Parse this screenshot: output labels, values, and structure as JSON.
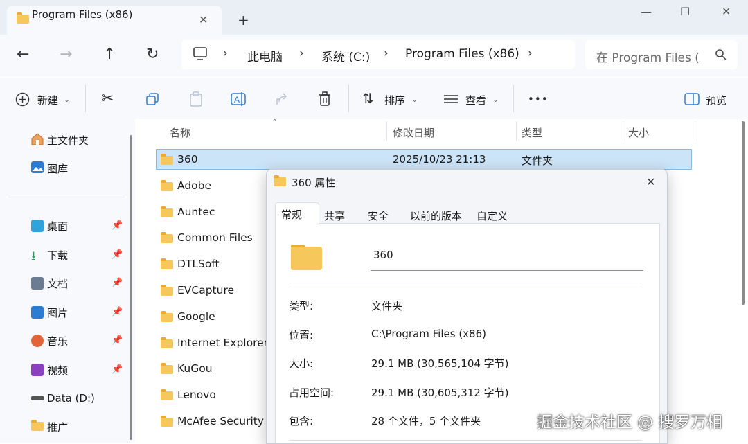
{
  "window": {
    "tab_title": "Program Files (x86)",
    "tab_close": "✕",
    "new_tab": "+",
    "minimize": "—",
    "maximize": "☐",
    "close": "✕"
  },
  "nav": {
    "back": "←",
    "forward": "→",
    "up": "↑",
    "refresh": "↻"
  },
  "breadcrumb": {
    "items": [
      "此电脑",
      "系统 (C:)",
      "Program Files (x86)"
    ],
    "separator": "›"
  },
  "search": {
    "placeholder": "在 Program Files (x"
  },
  "toolbar": {
    "new_label": "新建",
    "sort_label": "排序",
    "view_label": "查看",
    "more_label": "•••",
    "preview_label": "预览"
  },
  "sidebar": {
    "top_items": [
      {
        "label": "主文件夹",
        "icon": "home-icon"
      },
      {
        "label": "图库",
        "icon": "gallery-icon"
      }
    ],
    "pinned_items": [
      {
        "label": "桌面",
        "icon": "desktop-icon",
        "color": "#2fa3dc"
      },
      {
        "label": "下载",
        "icon": "download-icon",
        "color": "#2a9d5b"
      },
      {
        "label": "文档",
        "icon": "document-icon",
        "color": "#6b7c93"
      },
      {
        "label": "图片",
        "icon": "pictures-icon",
        "color": "#2b7cd3"
      },
      {
        "label": "音乐",
        "icon": "music-icon",
        "color": "#e0663a"
      },
      {
        "label": "视频",
        "icon": "video-icon",
        "color": "#8b3fc1"
      }
    ],
    "drive_items": [
      {
        "label": "Data (D:)",
        "icon": "drive-icon"
      },
      {
        "label": "推广",
        "icon": "folder-icon"
      }
    ]
  },
  "file_list": {
    "columns": [
      "名称",
      "修改日期",
      "类型",
      "大小"
    ],
    "rows": [
      {
        "name": "360",
        "date": "2025/10/23 21:13",
        "type": "文件夹",
        "selected": true
      },
      {
        "name": "Adobe"
      },
      {
        "name": "Auntec"
      },
      {
        "name": "Common Files"
      },
      {
        "name": "DTLSoft"
      },
      {
        "name": "EVCapture"
      },
      {
        "name": "Google"
      },
      {
        "name": "Internet Explorer"
      },
      {
        "name": "KuGou"
      },
      {
        "name": "Lenovo"
      },
      {
        "name": "McAfee Security"
      }
    ]
  },
  "dialog": {
    "title": "360 属性",
    "close": "✕",
    "tabs": [
      "常规",
      "共享",
      "安全",
      "以前的版本",
      "自定义"
    ],
    "active_tab": "常规",
    "name_value": "360",
    "props": [
      {
        "label": "类型:",
        "value": "文件夹"
      },
      {
        "label": "位置:",
        "value": "C:\\Program Files (x86)"
      },
      {
        "label": "大小:",
        "value": "29.1 MB (30,565,104 字节)"
      },
      {
        "label": "占用空间:",
        "value": "29.1 MB (30,605,312 字节)"
      },
      {
        "label": "包含:",
        "value": "28 个文件，5 个文件夹"
      }
    ]
  },
  "watermark": "掘金技术社区 @ 搜罗万相",
  "colors": {
    "selection": "#cce4f7",
    "folder": "#f6c75a",
    "accent": "#2b7cd3"
  }
}
